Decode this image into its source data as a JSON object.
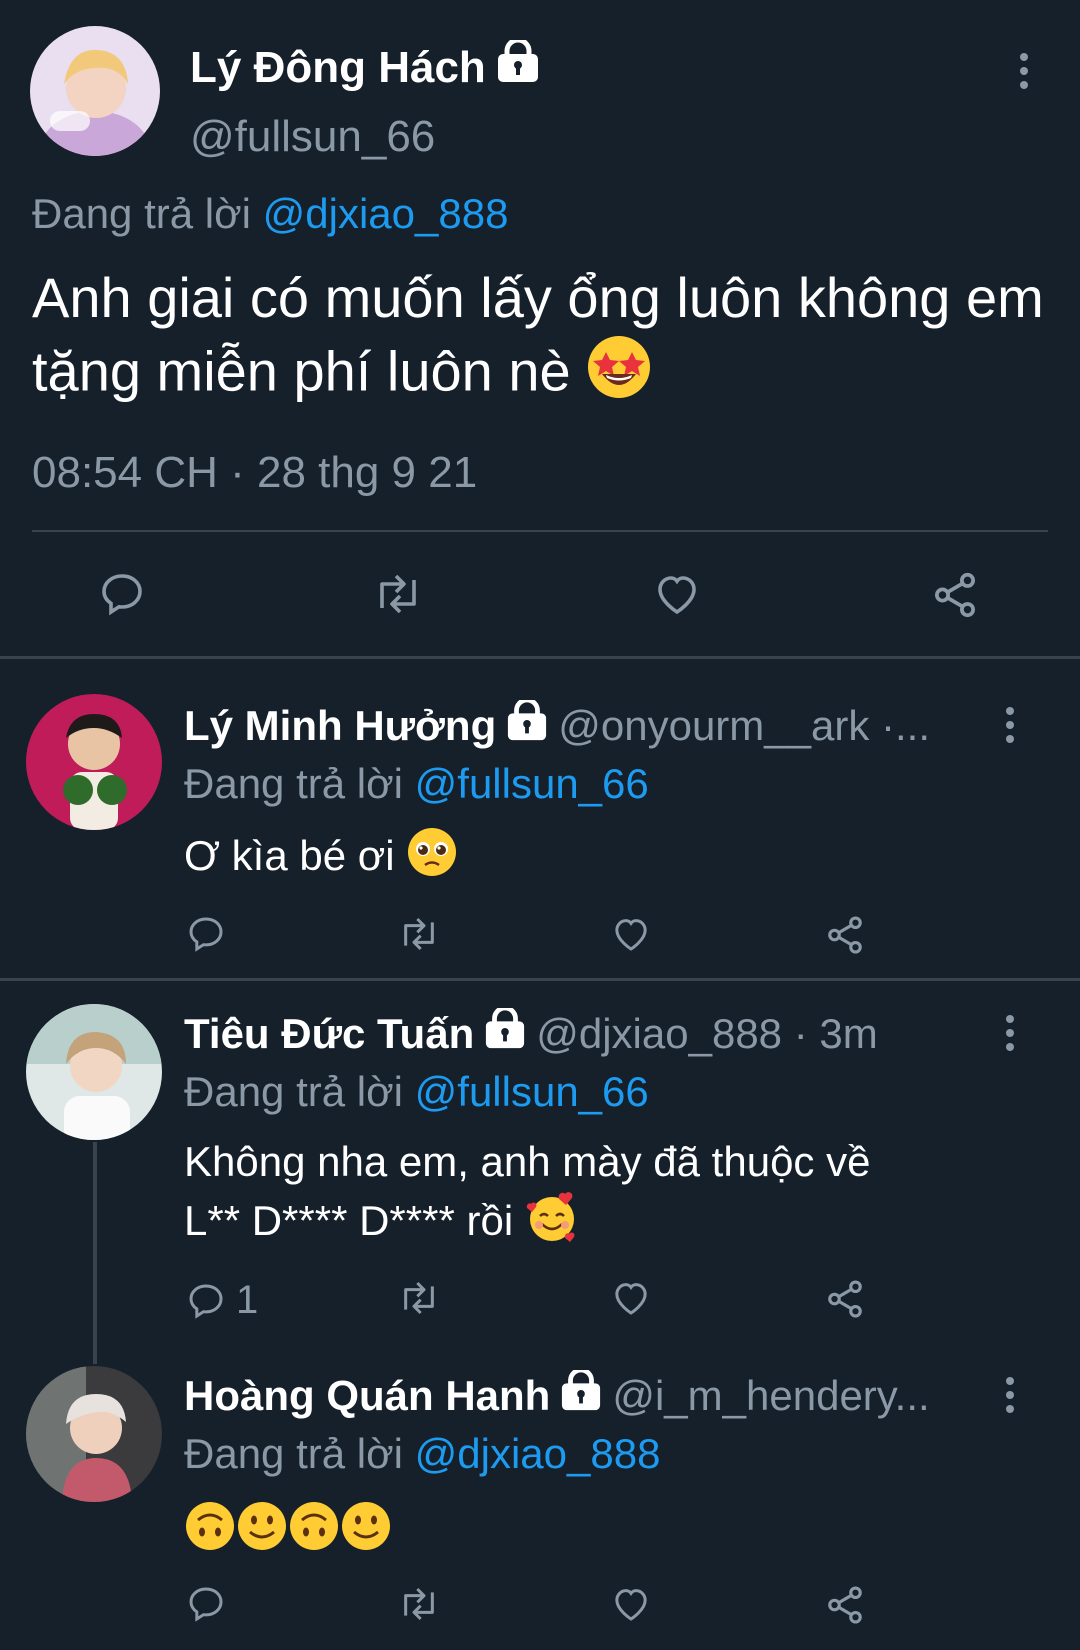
{
  "main_tweet": {
    "display_name": "Lý Đông Hách",
    "handle": "@fullsun_66",
    "replying_prefix": "Đang trả lời",
    "replying_to": "@djxiao_888",
    "text": "Anh giai có muốn lấy ổng luôn không em tặng miễn phí luôn nè",
    "timestamp": "08:54 CH · 28 thg 9 21"
  },
  "replies": [
    {
      "display_name": "Lý Minh Hưởng",
      "handle": "@onyourm__ark ·...",
      "replying_prefix": "Đang trả lời",
      "replying_to": "@fullsun_66",
      "text": "Ơ kìa bé ơi",
      "reply_count": ""
    },
    {
      "display_name": "Tiêu Đức Tuấn",
      "handle": "@djxiao_888 · 3m",
      "replying_prefix": "Đang trả lời",
      "replying_to": "@fullsun_66",
      "text_line1": "Không nha em, anh mày đã thuộc về",
      "text_line2": "L** D**** D**** rồi",
      "reply_count": "1"
    },
    {
      "display_name": "Hoàng Quán Hanh",
      "handle": "@i_m_hendery...",
      "replying_prefix": "Đang trả lời",
      "replying_to": "@djxiao_888",
      "text": "",
      "reply_count": ""
    }
  ],
  "colors": {
    "background": "#15202b",
    "muted": "#8b98a5",
    "link": "#1d9bf0",
    "divider": "#38444d"
  }
}
